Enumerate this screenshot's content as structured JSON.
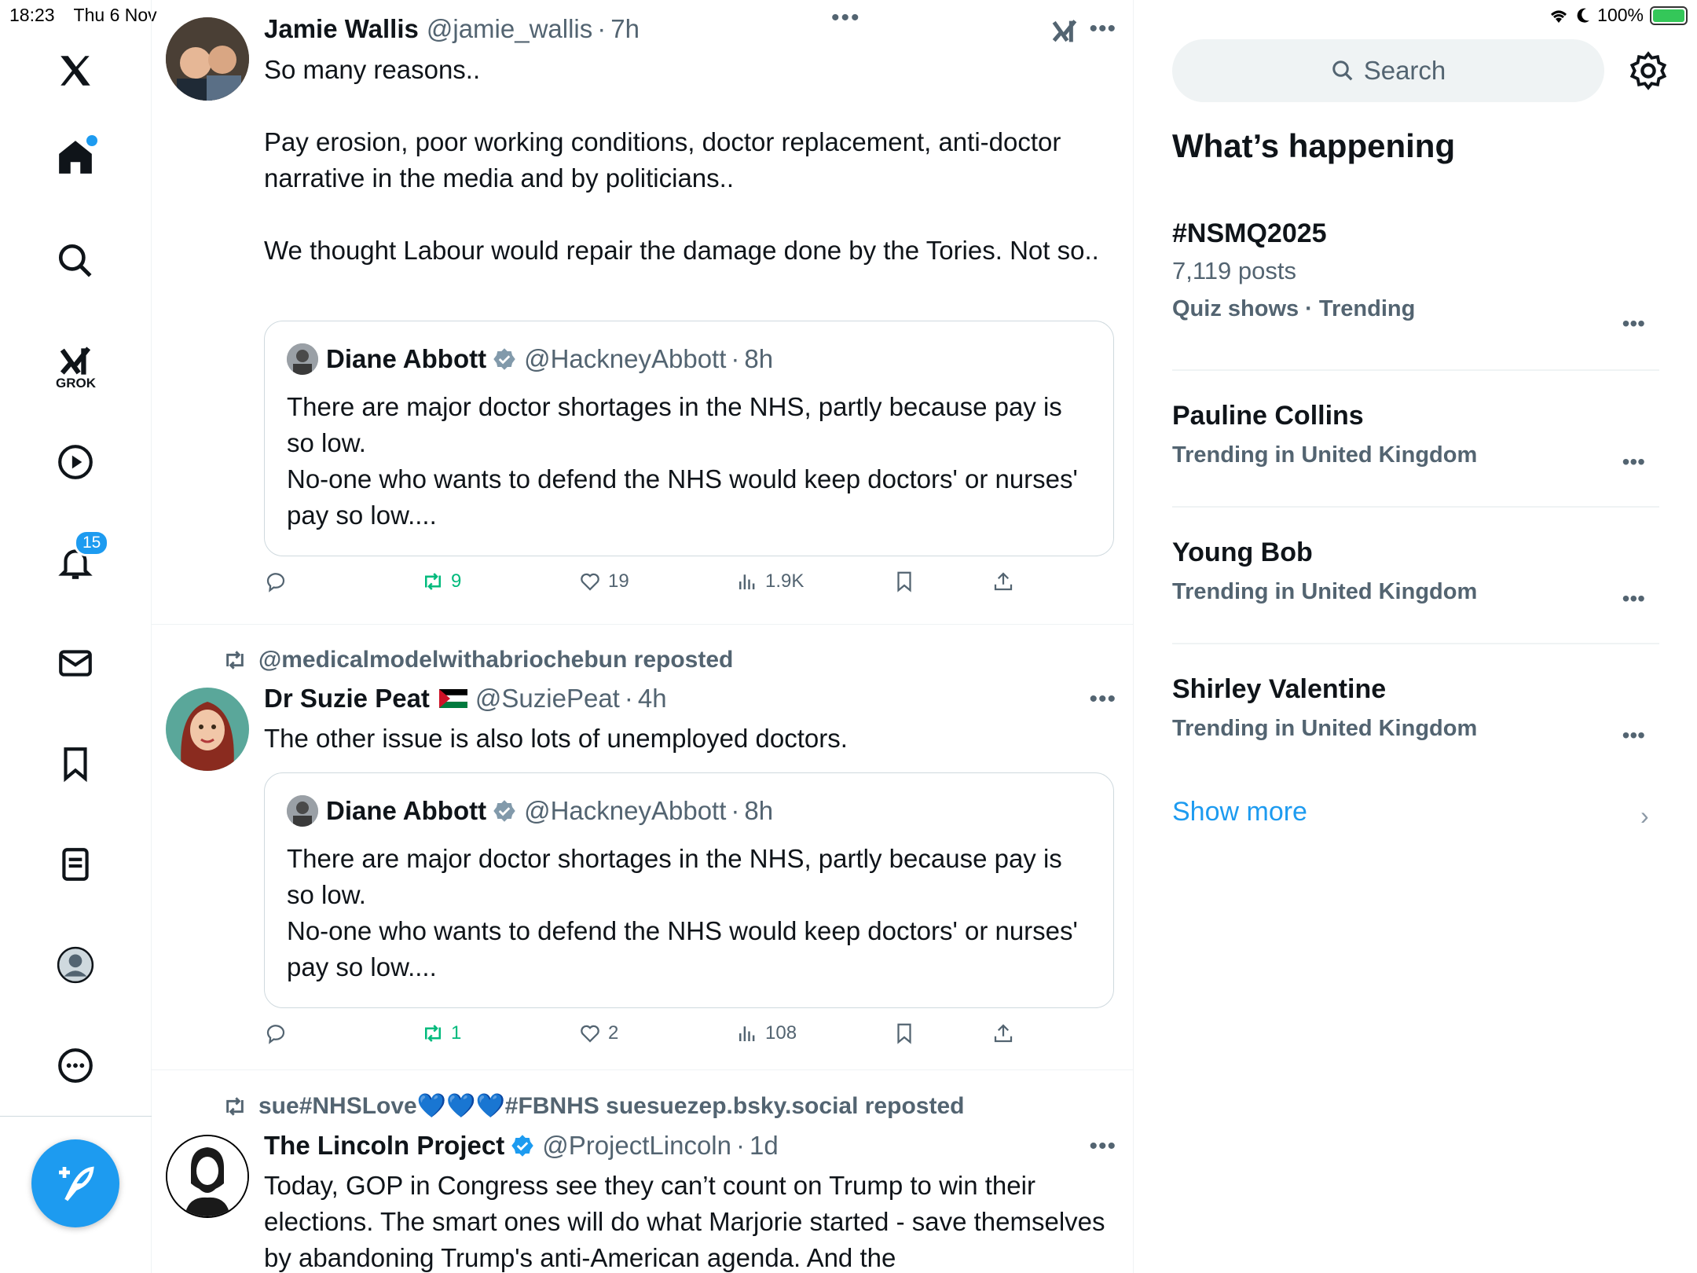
{
  "status": {
    "time": "18:23",
    "date": "Thu 6 Nov",
    "battery": "100%",
    "battery_level": 1.0
  },
  "nav": {
    "grok_label": "GROK",
    "notifications_count": "15"
  },
  "tweets": [
    {
      "repost_by": "",
      "name": "Jamie Wallis",
      "handle": "@jamie_wallis",
      "time": "7h",
      "text": "So many reasons..\n\nPay erosion, poor working conditions, doctor replacement, anti-doctor narrative in the media and by politicians..\n\nWe thought Labour would repair the damage done by the Tories. Not so..",
      "quote": {
        "name": "Diane Abbott",
        "handle": "@HackneyAbbott",
        "time": "8h",
        "text": "There are major doctor shortages in the NHS, partly because pay is so low.\nNo-one who wants to defend the NHS would keep doctors' or nurses' pay so low...."
      },
      "replies": "",
      "retweets": "9",
      "likes": "19",
      "views": "1.9K"
    },
    {
      "repost_by": "@medicalmodelwithabriochebun reposted",
      "name": "Dr Suzie Peat",
      "handle": "@SuziePeat",
      "time": "4h",
      "text": "The other issue is also lots of unemployed doctors.",
      "quote": {
        "name": "Diane Abbott",
        "handle": "@HackneyAbbott",
        "time": "8h",
        "text": "There are major doctor shortages in the NHS, partly because pay is so low.\nNo-one who wants to defend the NHS would keep doctors' or nurses' pay so low...."
      },
      "replies": "",
      "retweets": "1",
      "likes": "2",
      "views": "108"
    },
    {
      "repost_by": "sue#NHSLove💙💙💙#FBNHS suesuezep.bsky.social reposted",
      "name": "The Lincoln Project",
      "handle": "@ProjectLincoln",
      "time": "1d",
      "text": "Today, GOP in Congress see they can’t count on Trump to win their elections. The smart ones will do what Marjorie started - save themselves by abandoning Trump's anti-American agenda. And the"
    }
  ],
  "sidebar": {
    "search_placeholder": "Search",
    "section_title": "What’s happening",
    "trends": [
      {
        "name": "#NSMQ2025",
        "posts": "7,119 posts",
        "category": "Quiz shows · Trending"
      },
      {
        "name": "Pauline Collins",
        "posts": "",
        "category": "Trending in United Kingdom"
      },
      {
        "name": "Young Bob",
        "posts": "",
        "category": "Trending in United Kingdom"
      },
      {
        "name": "Shirley Valentine",
        "posts": "",
        "category": "Trending in United Kingdom"
      }
    ],
    "show_more": "Show more"
  },
  "colors": {
    "accent": "#1d9bf0",
    "retweet": "#00ba7c",
    "muted": "#536471"
  }
}
